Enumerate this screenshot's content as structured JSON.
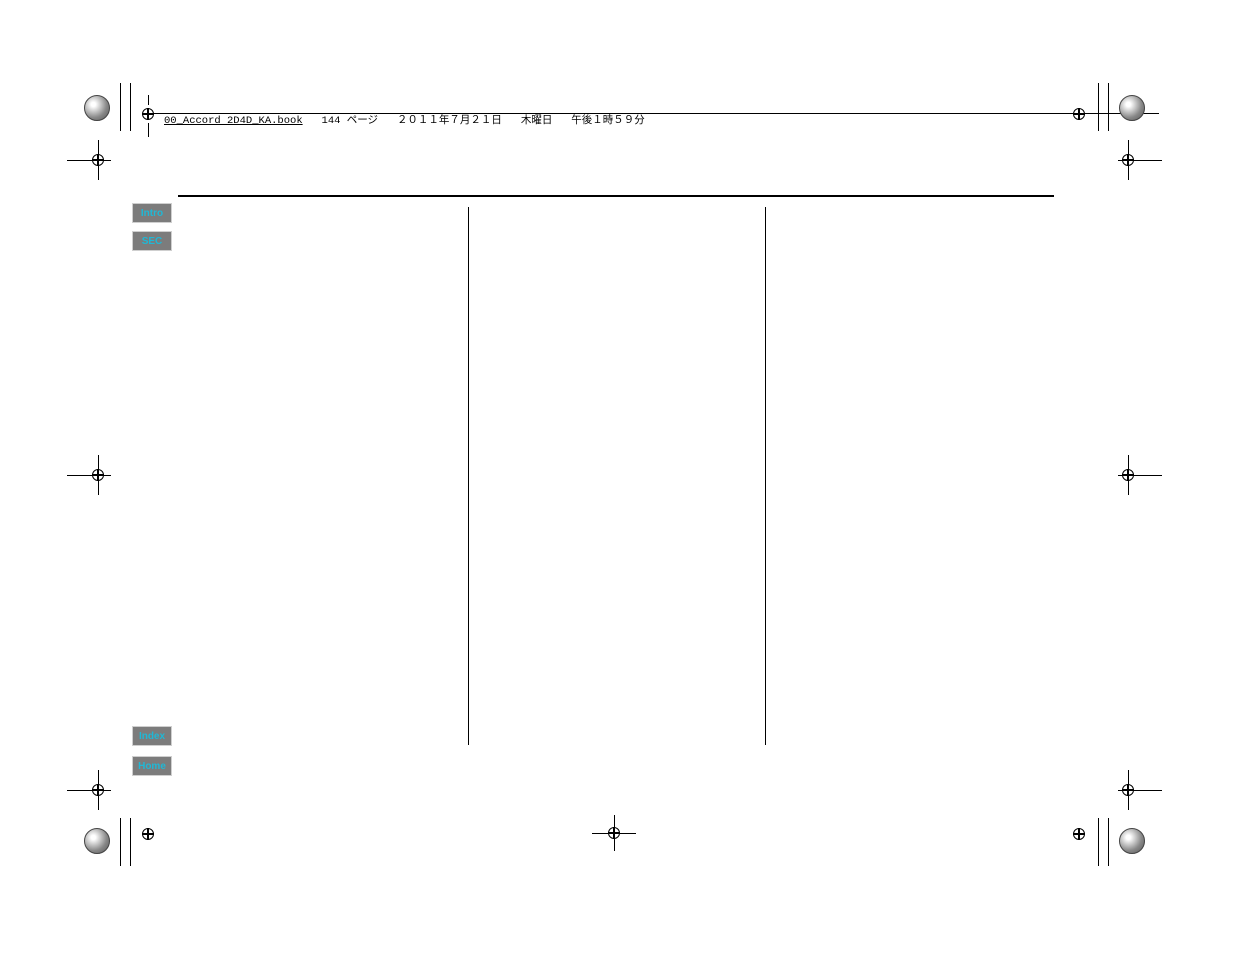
{
  "header": {
    "file": "00_Accord 2D4D_KA.book",
    "page_label": "144 ページ",
    "date": "２０１１年７月２１日",
    "weekday": "木曜日",
    "time": "午後１時５９分"
  },
  "nav": {
    "intro": "Intro",
    "sec": "SEC",
    "index": "Index",
    "home": "Home"
  }
}
